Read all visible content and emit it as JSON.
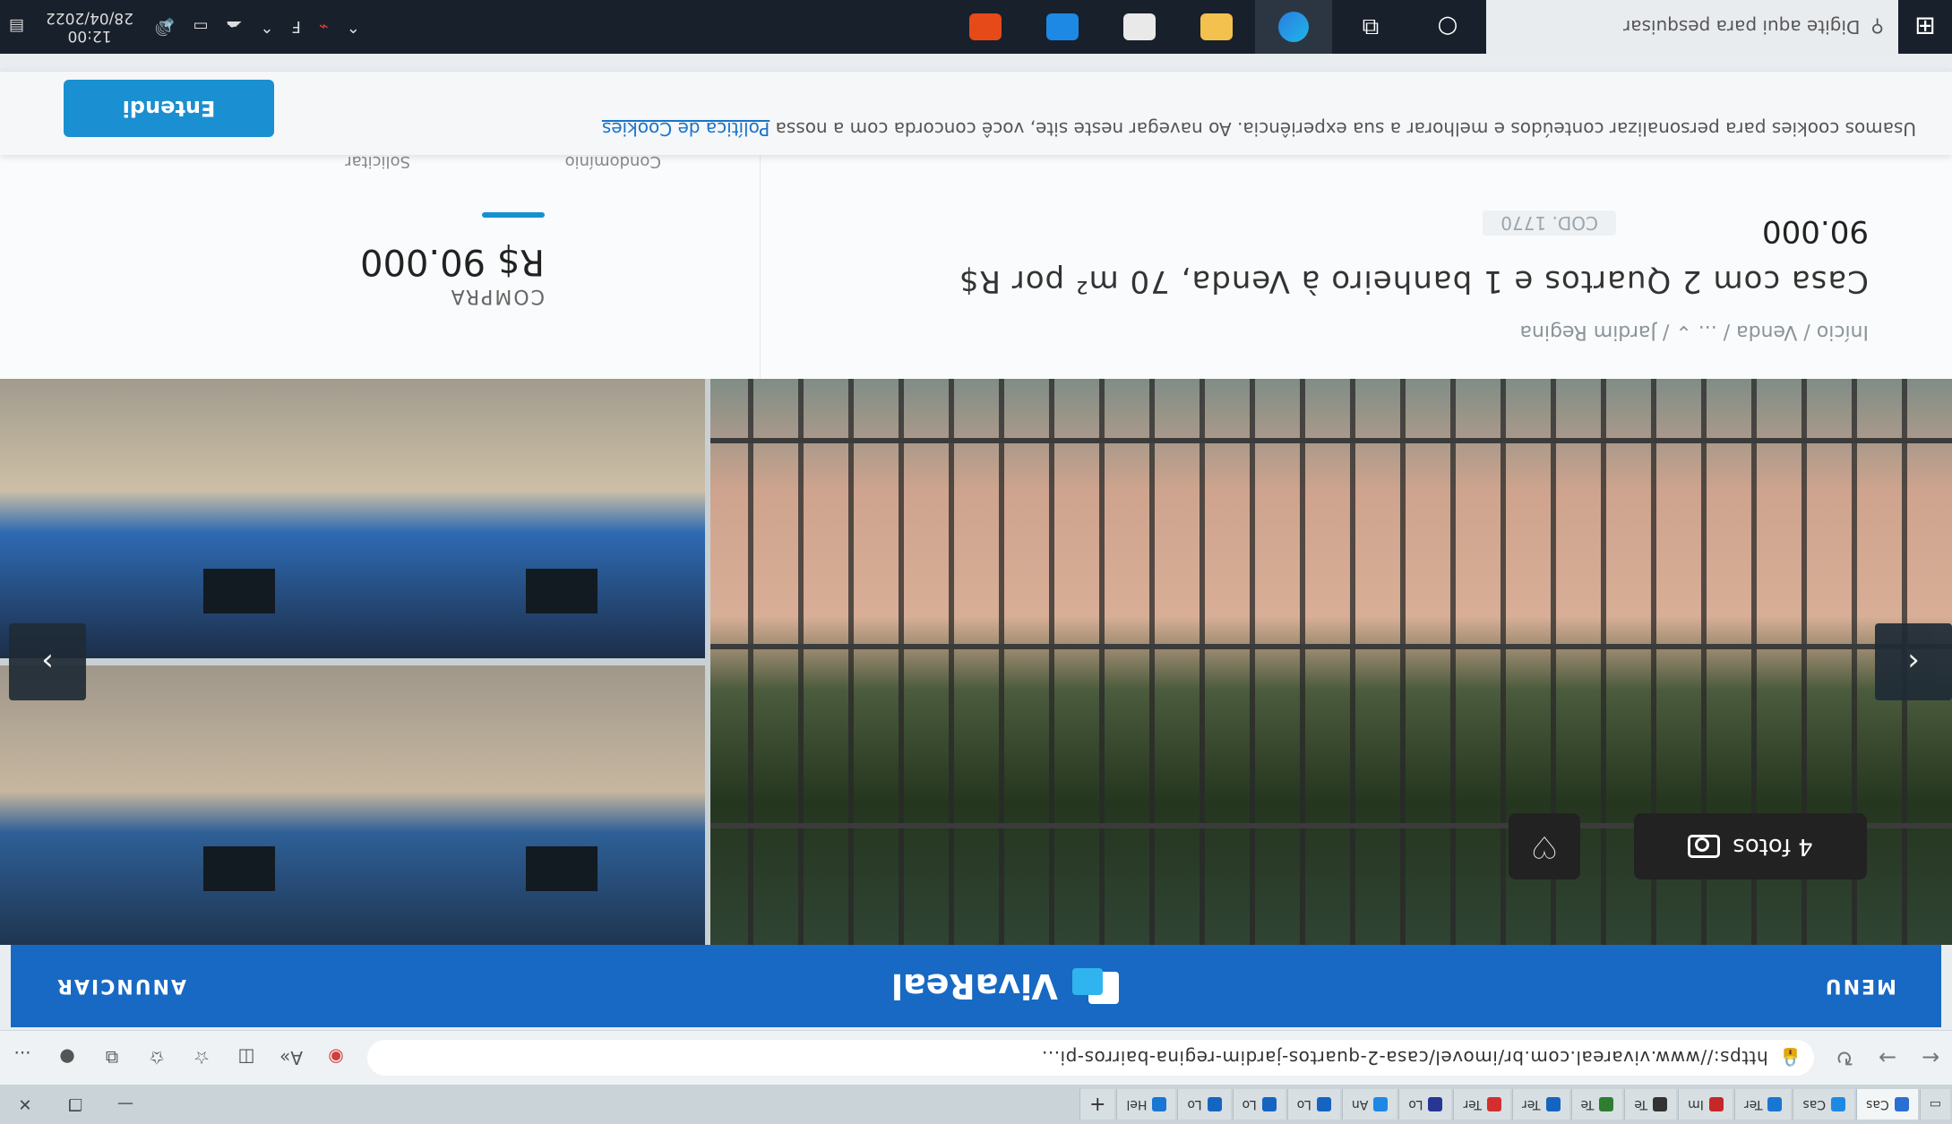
{
  "browser": {
    "tabs": [
      {
        "label": "Cas",
        "color": "#2b6fd1"
      },
      {
        "label": "Cas",
        "color": "#1e88e5"
      },
      {
        "label": "Ter",
        "color": "#1976d2"
      },
      {
        "label": "Im",
        "color": "#c62828"
      },
      {
        "label": "Te",
        "color": "#333333"
      },
      {
        "label": "Te",
        "color": "#2e7d32"
      },
      {
        "label": "Ter",
        "color": "#1565c0"
      },
      {
        "label": "Ter",
        "color": "#d32f2f"
      },
      {
        "label": "Lo",
        "color": "#283593"
      },
      {
        "label": "An",
        "color": "#1e88e5"
      },
      {
        "label": "Lo",
        "color": "#1565c0"
      },
      {
        "label": "Lo",
        "color": "#1565c0"
      },
      {
        "label": "Lo",
        "color": "#1565c0"
      },
      {
        "label": "Hel",
        "color": "#1976d2"
      }
    ],
    "url": "https://www.vivareal.com.br/imovel/casa-2-quartos-jardim-regina-bairros-pi...",
    "more_label": "..."
  },
  "site": {
    "menu_label": "MENU",
    "logo_text": "VivaReal",
    "announce_label": "ANUNCIAR"
  },
  "gallery": {
    "photos_label": "4 fotos"
  },
  "listing": {
    "breadcrumb": "Início / Venda / ... ⌄ / Jardim Regina",
    "title": "Casa com 2 Quartos e 1 banheiro à Venda, 70 m² por R$",
    "price_line": "90.000",
    "ref_code": "COD. 1770",
    "purchase_label": "COMPRA",
    "purchase_price": "R$ 90.000",
    "condo_label": "Condomínio",
    "request_label": "Solicitar"
  },
  "cookie": {
    "text": "Usamos cookies para personalizar conteúdos e melhorar a sua experiência. Ao navegar neste site, você concorda com a nossa",
    "link": "Política de Cookies",
    "accept": "Entendi"
  },
  "taskbar": {
    "search_placeholder": "Digite aqui para pesquisar",
    "time": "12:00",
    "date": "28/04/2022",
    "tray_letter": "F"
  }
}
